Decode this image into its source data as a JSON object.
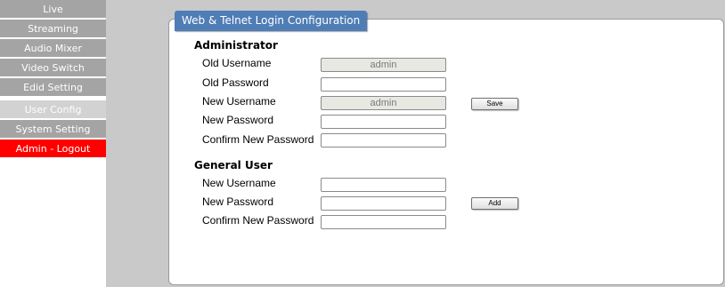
{
  "sidebar": {
    "items": [
      {
        "label": "Live",
        "state": "normal"
      },
      {
        "label": "Streaming",
        "state": "normal"
      },
      {
        "label": "Audio Mixer",
        "state": "normal"
      },
      {
        "label": "Video Switch",
        "state": "normal"
      },
      {
        "label": "Edid Setting",
        "state": "normal"
      },
      {
        "label": "User Config",
        "state": "active"
      },
      {
        "label": "System Setting",
        "state": "normal"
      },
      {
        "label": "Admin - Logout",
        "state": "logout"
      }
    ]
  },
  "panel": {
    "title": "Web & Telnet Login Configuration"
  },
  "administrator": {
    "title": "Administrator",
    "old_username_label": "Old Username",
    "old_username_value": "admin",
    "old_password_label": "Old Password",
    "old_password_value": "",
    "new_username_label": "New Username",
    "new_username_value": "admin",
    "new_password_label": "New Password",
    "new_password_value": "",
    "confirm_password_label": "Confirm New Password",
    "confirm_password_value": "",
    "save_label": "Save"
  },
  "general_user": {
    "title": "General User",
    "new_username_label": "New Username",
    "new_username_value": "",
    "new_password_label": "New Password",
    "new_password_value": "",
    "confirm_password_label": "Confirm New Password",
    "confirm_password_value": "",
    "add_label": "Add"
  },
  "colors": {
    "sidebar_item": "#a4a4a4",
    "sidebar_active": "#d2d2d2",
    "logout": "#ff0000",
    "panel_tab": "#4f7db6",
    "content_bg": "#c9c9c9"
  }
}
